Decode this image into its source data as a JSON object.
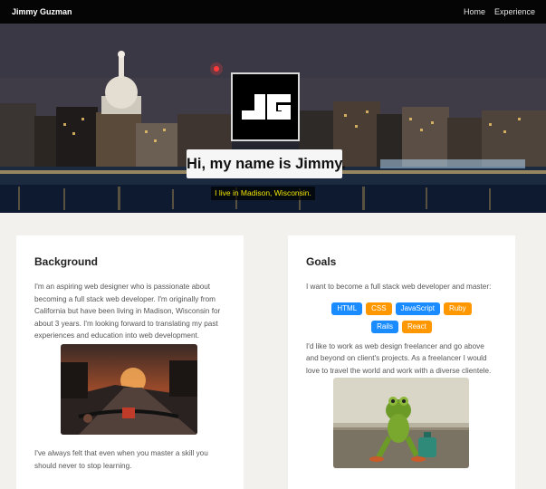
{
  "nav": {
    "brand": "Jimmy Guzman",
    "links": [
      "Home",
      "Experience"
    ]
  },
  "hero": {
    "logo_text": "JG",
    "title": "Hi, my name is Jimmy.",
    "subtitle": "I live in Madison, Wisconsin."
  },
  "background": {
    "heading": "Background",
    "para1": "I'm an aspiring web designer who is passionate about becoming a full stack web developer. I'm originally from California but have been living in Madison, Wisconsin for about 3 years. I'm looking forward to translating my past experiences and education into web development.",
    "para2": "I've always felt that even when you master a skill you should never to stop learning.",
    "image": "bicycle-handlebar-road-photo"
  },
  "goals": {
    "heading": "Goals",
    "para1": "I want to become a full stack web developer and master:",
    "tags": [
      {
        "label": "HTML",
        "color": "#1a8cff"
      },
      {
        "label": "CSS",
        "color": "#ff9800"
      },
      {
        "label": "JavaScript",
        "color": "#1a8cff"
      },
      {
        "label": "Ruby",
        "color": "#ff9800"
      },
      {
        "label": "Rails",
        "color": "#1a8cff"
      },
      {
        "label": "React",
        "color": "#ff9800"
      }
    ],
    "para2": "I'd like to work as web design freelancer and go above and beyond on client's projects. As a freelancer I would love to travel the world and work with a diverse clientele.",
    "image": "frog-with-suitcase-photo"
  },
  "colors": {
    "navbar": "#050505",
    "page_bg": "#f2f1ed",
    "subtitle_text": "#f2e600",
    "tag_blue": "#1a8cff",
    "tag_orange": "#ff9800"
  }
}
